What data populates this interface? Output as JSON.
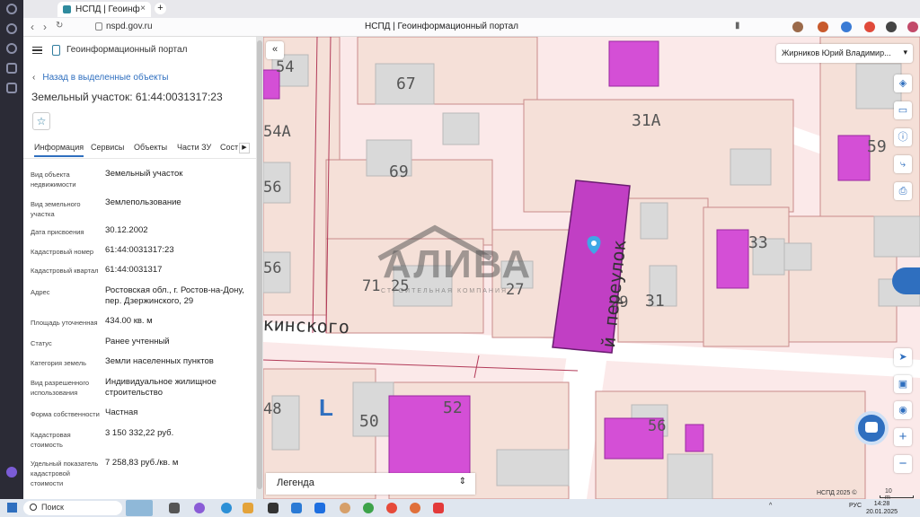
{
  "browser": {
    "tab_title": "НСПД | Геоинформационный портал",
    "url": "nspd.gov.ru",
    "page_title": "НСПД | Геоинформационный портал"
  },
  "panel": {
    "portal_name": "Геоинформационный портал",
    "back_link": "Назад в выделенные объекты",
    "title": "Земельный участок: 61:44:0031317:23",
    "tabs": [
      "Информация",
      "Сервисы",
      "Объекты",
      "Части ЗУ",
      "Состав"
    ],
    "rows": [
      {
        "k": "Вид объекта недвижимости",
        "v": "Земельный участок"
      },
      {
        "k": "Вид земельного участка",
        "v": "Землепользование"
      },
      {
        "k": "Дата присвоения",
        "v": "30.12.2002"
      },
      {
        "k": "Кадастровый номер",
        "v": "61:44:0031317:23"
      },
      {
        "k": "Кадастровый квартал",
        "v": "61:44:0031317"
      },
      {
        "k": "Адрес",
        "v": "Ростовская обл., г. Ростов-на-Дону, пер. Дзержинского, 29"
      },
      {
        "k": "Площадь уточненная",
        "v": "434.00 кв. м"
      },
      {
        "k": "Статус",
        "v": "Ранее учтенный"
      },
      {
        "k": "Категория земель",
        "v": "Земли населенных пунктов"
      },
      {
        "k": "Вид разрешенного использования",
        "v": "Индивидуальное жилищное строительство"
      },
      {
        "k": "Форма собственности",
        "v": "Частная"
      },
      {
        "k": "Кадастровая стоимость",
        "v": "3 150 332,22 руб."
      },
      {
        "k": "Удельный показатель кадастровой стоимости",
        "v": "7 258,83 руб./кв. м"
      }
    ]
  },
  "map": {
    "user_name": "Жирников Юрий Владимир...",
    "legend_label": "Легенда",
    "street_1": "кинского",
    "street_2": "й переулок",
    "scale_copyright": "НСПД 2025 ©",
    "scale_label": "10 m",
    "labels": [
      "54",
      "67",
      "54А",
      "31А",
      "56",
      "69",
      "59",
      "56",
      "33",
      "71",
      "25",
      "27",
      "29",
      "31",
      "48",
      "50",
      "52",
      "56",
      "L"
    ],
    "watermark_word": "АЛИВА",
    "watermark_sub": "СТРОИТЕЛЬНАЯ КОМПАНИЯ",
    "colors": {
      "parcel_fill": "#f5e0d8",
      "parcel_line": "#c98a8a",
      "building_fill": "#d9d9d9",
      "selected_fill": "#c13fc4",
      "highlight_fill": "#d44fd6",
      "street": "#ffffff"
    }
  },
  "taskbar": {
    "search": "Поиск",
    "lang": "РУС",
    "time": "14:28",
    "date": "20.01.2025"
  }
}
